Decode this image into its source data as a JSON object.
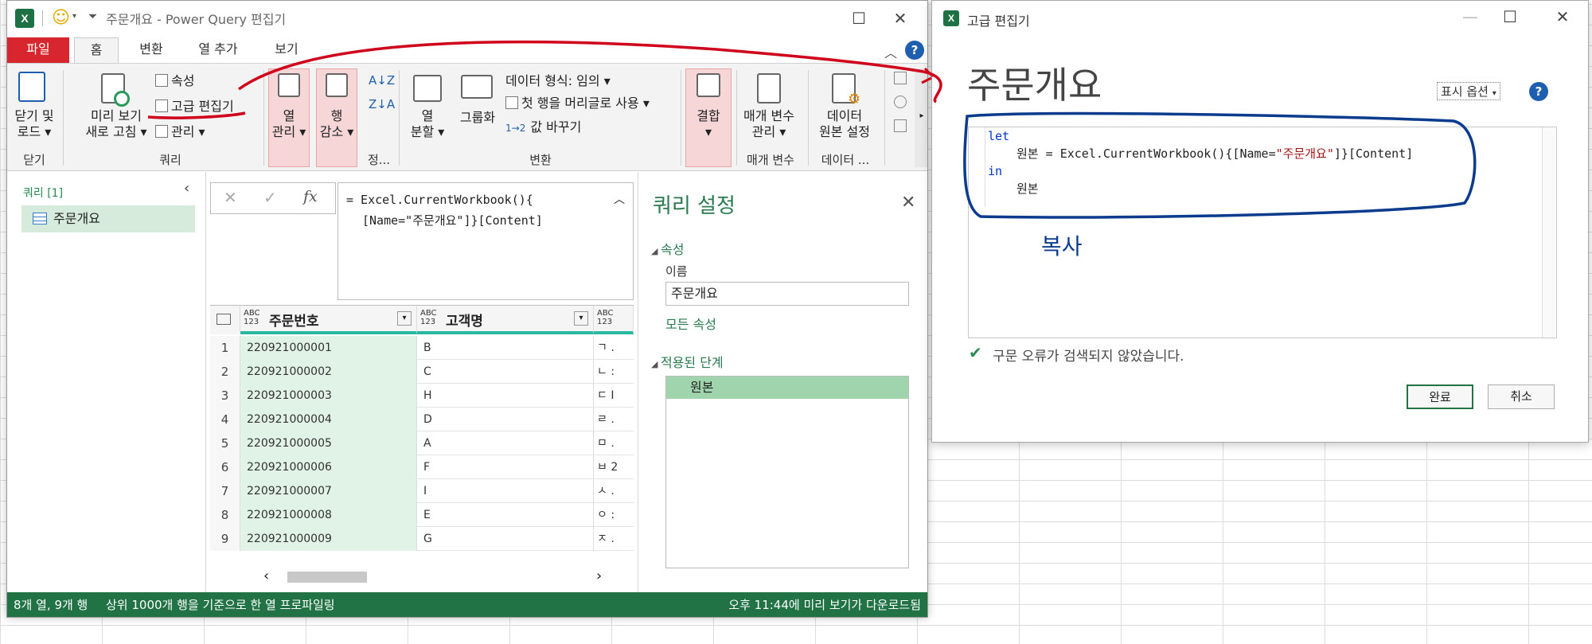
{
  "colors": {
    "accent": "#217346",
    "file_tab": "#d7262e",
    "selected_col": "#e1f2e6",
    "col_underline": "#28b8a0",
    "annotation_red": "#d0021b",
    "annotation_blue": "#0b3b8c"
  },
  "pq": {
    "title": "주문개요 - Power Query 편집기",
    "tabs": [
      "파일",
      "홈",
      "변환",
      "열 추가",
      "보기"
    ],
    "ribbon": {
      "close_load": [
        "닫기 및",
        "로드 ▾"
      ],
      "close_group": "닫기",
      "refresh_preview": [
        "미리 보기",
        "새로 고침 ▾"
      ],
      "properties": "속성",
      "advanced_editor": "고급 편집기",
      "manage": "관리 ▾",
      "query_group": "쿼리",
      "manage_columns": [
        "열",
        "관리 ▾"
      ],
      "reduce_rows": [
        "행",
        "감소 ▾"
      ],
      "sort_group": "정...",
      "split_column": [
        "열",
        "분할 ▾"
      ],
      "group_by": "그룹화",
      "data_type": "데이터 형식: 임의 ▾",
      "first_row_header": "첫 행을 머리글로 사용 ▾",
      "replace_values": "값 바꾸기",
      "transform_group": "변환",
      "combine": [
        "결합",
        "▾"
      ],
      "manage_params": [
        "매개 변수",
        "관리 ▾"
      ],
      "params_group": "매개 변수",
      "data_source": [
        "데이터",
        "원본 설정"
      ],
      "data_group": "데이터 ..."
    },
    "queries_pane": {
      "header": "쿼리 [1]",
      "item": "주문개요"
    },
    "formula": {
      "cancel": "✕",
      "commit": "✓",
      "fx": "fx",
      "line1": "= Excel.CurrentWorkbook(){",
      "line2": "[Name=\"주문개요\"]}[Content]"
    },
    "grid": {
      "columns": [
        {
          "type": "ABC\n123",
          "name": "주문번호"
        },
        {
          "type": "ABC\n123",
          "name": "고객명"
        },
        {
          "type": "ABC\n123",
          "name": ""
        }
      ],
      "rows": [
        {
          "n": "1",
          "id": "220921000001",
          "name": "B",
          "c3": "ㄱ ."
        },
        {
          "n": "2",
          "id": "220921000002",
          "name": "C",
          "c3": "ㄴ :"
        },
        {
          "n": "3",
          "id": "220921000003",
          "name": "H",
          "c3": "ㄷ I"
        },
        {
          "n": "4",
          "id": "220921000004",
          "name": "D",
          "c3": "ㄹ ."
        },
        {
          "n": "5",
          "id": "220921000005",
          "name": "A",
          "c3": "ㅁ ."
        },
        {
          "n": "6",
          "id": "220921000006",
          "name": "F",
          "c3": "ㅂ 2"
        },
        {
          "n": "7",
          "id": "220921000007",
          "name": "I",
          "c3": "ㅅ ."
        },
        {
          "n": "8",
          "id": "220921000008",
          "name": "E",
          "c3": "ㅇ :"
        },
        {
          "n": "9",
          "id": "220921000009",
          "name": "G",
          "c3": "ㅈ ."
        }
      ]
    },
    "settings": {
      "title": "쿼리 설정",
      "properties": "속성",
      "name_label": "이름",
      "name_value": "주문개요",
      "all_properties": "모든 속성",
      "applied_steps": "적용된 단계",
      "step1": "원본"
    },
    "status": {
      "left1": "8개 열, 9개 행",
      "left2": "상위 1000개 행을 기준으로 한 열 프로파일링",
      "right": "오후 11:44에 미리 보기가 다운로드됨"
    }
  },
  "ae": {
    "window_title": "고급 편집기",
    "heading": "주문개요",
    "display_options": "표시 옵션",
    "code": {
      "l1": "let",
      "l2a": "원본 = Excel.CurrentWorkbook(){[Name=",
      "l2s": "\"주문개요\"",
      "l2b": "]}[Content]",
      "l3": "in",
      "l4": "원본"
    },
    "annotation": "복사",
    "syntax_status": "구문 오류가 검색되지 않았습니다.",
    "done": "완료",
    "cancel": "취소"
  }
}
